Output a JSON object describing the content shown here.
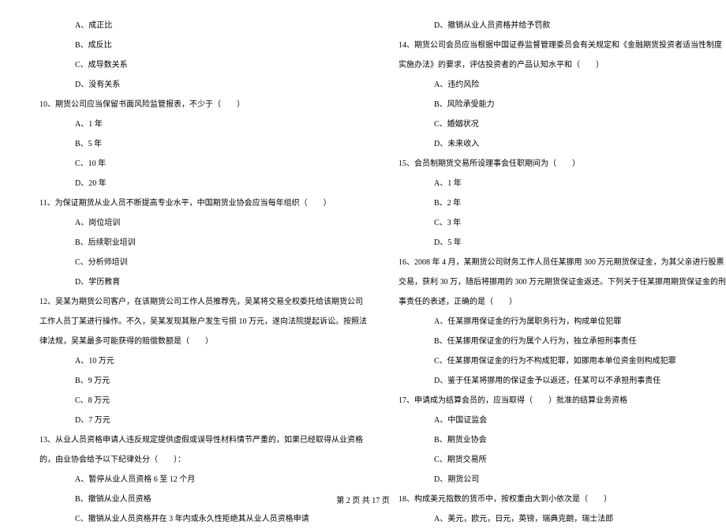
{
  "left_column": [
    {
      "type": "option",
      "text": "A、成正比"
    },
    {
      "type": "option",
      "text": "B、成反比"
    },
    {
      "type": "option",
      "text": "C、成导数关系"
    },
    {
      "type": "option",
      "text": "D、没有关系"
    },
    {
      "type": "question",
      "text": "10、期货公司应当保留书面风险监管报表，不少于（　　）"
    },
    {
      "type": "option",
      "text": "A、1 年"
    },
    {
      "type": "option",
      "text": "B、5 年"
    },
    {
      "type": "option",
      "text": "C、10 年"
    },
    {
      "type": "option",
      "text": "D、20 年"
    },
    {
      "type": "question",
      "text": "11、为保证期货从业人员不断提高专业水平，中国期货业协会应当每年组织（　　）"
    },
    {
      "type": "option",
      "text": "A、岗位培训"
    },
    {
      "type": "option",
      "text": "B、后续职业培训"
    },
    {
      "type": "option",
      "text": "C、分析师培训"
    },
    {
      "type": "option",
      "text": "D、学历教育"
    },
    {
      "type": "question",
      "text": "12、吴某为期货公司客户，在该期货公司工作人员推荐先，吴某将交易全权委托给该期货公司"
    },
    {
      "type": "question-continue",
      "text": "工作人员丁某进行操作。不久，吴某发现其账户发生亏损 10 万元，遂向法院提起诉讼。按照法"
    },
    {
      "type": "question-continue",
      "text": "律法规，吴某最多可能获得的赔偿数额是（　　）"
    },
    {
      "type": "option",
      "text": "A、10 万元"
    },
    {
      "type": "option",
      "text": "B、9 万元"
    },
    {
      "type": "option",
      "text": "C、8 万元"
    },
    {
      "type": "option",
      "text": "D、7 万元"
    },
    {
      "type": "question",
      "text": "13、从业人员资格申请人违反规定提供虚假或误导性材料情节严重的，如果已经取得从业资格"
    },
    {
      "type": "question-continue",
      "text": "的，由业协会给予以下纪律处分（　　）："
    },
    {
      "type": "option",
      "text": "A、暂停从业人员资格 6 至 12 个月"
    },
    {
      "type": "option",
      "text": "B、撤销从业人员资格"
    },
    {
      "type": "option",
      "text": "C、撤销从业人员资格并在 3 年内或永久性拒绝其从业人员资格申请"
    }
  ],
  "right_column": [
    {
      "type": "option",
      "text": "D、撤销从业人员资格并给予罚款"
    },
    {
      "type": "question",
      "text": "14、期货公司会员应当根据中国证券监督管理委员会有关规定和《金融期货投资者适当性制度"
    },
    {
      "type": "question-continue",
      "text": "实施办法》的要求，评估投资者的产品认知水平和（　　）"
    },
    {
      "type": "option",
      "text": "A、违约风险"
    },
    {
      "type": "option",
      "text": "B、风险承受能力"
    },
    {
      "type": "option",
      "text": "C、婚姻状况"
    },
    {
      "type": "option",
      "text": "D、未来收入"
    },
    {
      "type": "question",
      "text": "15、会员制期货交易所设理事会任职期间为（　　）"
    },
    {
      "type": "option",
      "text": "A、1 年"
    },
    {
      "type": "option",
      "text": "B、2 年"
    },
    {
      "type": "option",
      "text": "C、3 年"
    },
    {
      "type": "option",
      "text": "D、5 年"
    },
    {
      "type": "question",
      "text": "16、2008 年 4 月，某期货公司财务工作人员任某挪用 300 万元期货保证金，为其父亲进行股票"
    },
    {
      "type": "question-continue",
      "text": "交易，获利 30 万，随后将挪用的 300 万元期货保证金返还。下列关于任某挪用期货保证金的刑"
    },
    {
      "type": "question-continue",
      "text": "事责任的表述，正确的是（　　）"
    },
    {
      "type": "option",
      "text": "A、任某挪用保证金的行为属职务行为，构成单位犯罪"
    },
    {
      "type": "option",
      "text": "B、任某挪用保证金的行为属个人行为，独立承担刑事责任"
    },
    {
      "type": "option",
      "text": "C、任某挪用保证金的行为不构成犯罪，如挪用本单位资金则构成犯罪"
    },
    {
      "type": "option",
      "text": "D、鉴于任某将挪用的保证金予以返还，任某可以不承担刑事责任"
    },
    {
      "type": "question",
      "text": "17、申请成为结算会员的，应当取得（　　）批准的结算业务资格"
    },
    {
      "type": "option",
      "text": "A、中国证监会"
    },
    {
      "type": "option",
      "text": "B、期货业协会"
    },
    {
      "type": "option",
      "text": "C、期货交易所"
    },
    {
      "type": "option",
      "text": "D、期货公司"
    },
    {
      "type": "question",
      "text": "18、构成美元指数的货币中，按权重由大到小依次是（　　）"
    },
    {
      "type": "option",
      "text": "A、美元，欧元，日元，英镑，瑞典克朗，瑞士法郎"
    }
  ],
  "footer": "第 2 页 共 17 页"
}
